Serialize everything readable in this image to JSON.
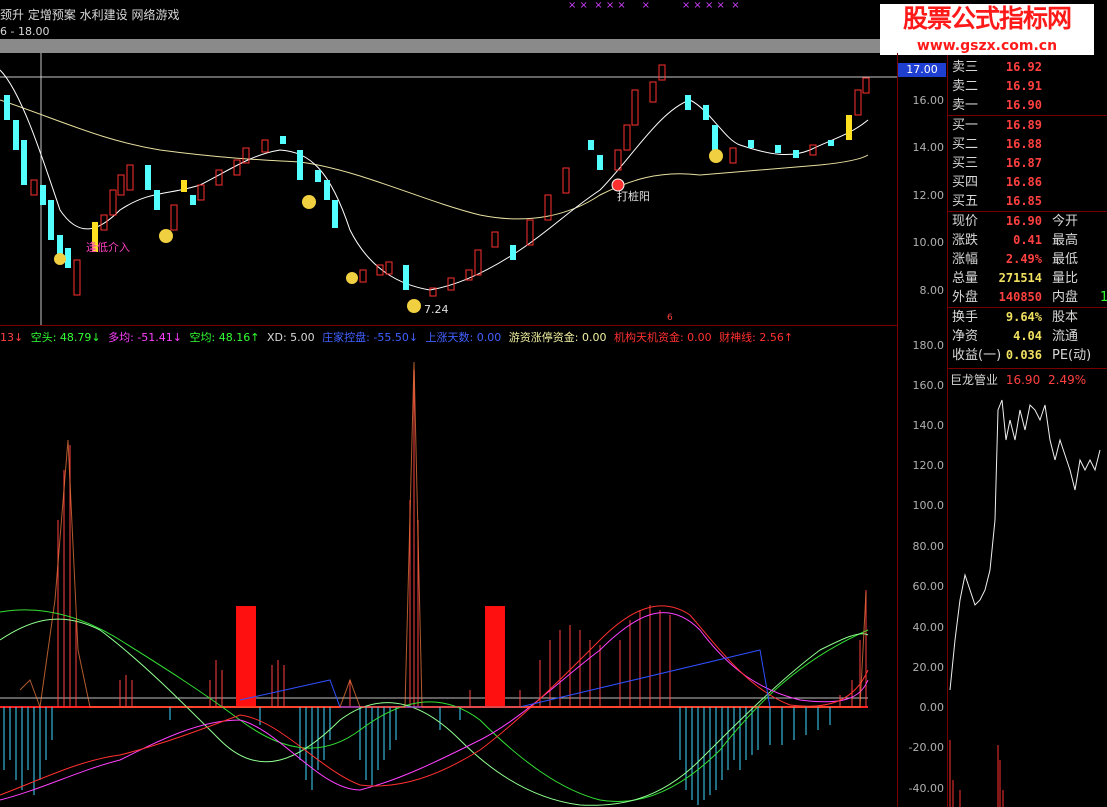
{
  "header": {
    "topline": "颈升 定增预案 水利建设 网络游戏",
    "daterange": "6 - 18.00",
    "markers": "× ×  × × ×     ×          × × × ×  ×",
    "markers_color": "#d040ff"
  },
  "brand": {
    "title": "股票公式指标网",
    "url": "www.gszx.com.cn",
    "color": "#ff1a1a"
  },
  "price_axis": {
    "current_tag": "17.00",
    "ticks": [
      "16.00",
      "14.00",
      "12.00",
      "10.00",
      "8.00"
    ]
  },
  "indicator_axis": {
    "ticks": [
      "180.0",
      "160.0",
      "140.0",
      "120.0",
      "100.0",
      "80.00",
      "60.00",
      "40.00",
      "20.00",
      "0.00",
      "-20.00",
      "-40.00"
    ]
  },
  "main_annotations": {
    "low_entry": "逢低介入",
    "low_price": "7.24",
    "stake_yang": "打桩阳",
    "marker_6": "6"
  },
  "indicator_line": {
    "items": [
      {
        "text": "13↓",
        "color": "#ff4040"
      },
      {
        "text": "空头: 48.79↓",
        "color": "#33ff33"
      },
      {
        "text": "多均: -51.41↓",
        "color": "#ff40ff"
      },
      {
        "text": "空均: 48.16↑",
        "color": "#33ff33"
      },
      {
        "text": "XD: 5.00",
        "color": "#d8d8d8"
      },
      {
        "text": "庄家控盘: -55.50↓",
        "color": "#4060ff"
      },
      {
        "text": "上涨天数: 0.00",
        "color": "#4060ff"
      },
      {
        "text": "游资涨停资金: 0.00",
        "color": "#f0f0a0"
      },
      {
        "text": "机构天机资金: 0.00",
        "color": "#ff3030"
      },
      {
        "text": "财神线: 2.56↑",
        "color": "#ff3030"
      }
    ]
  },
  "quotes": {
    "asks": [
      {
        "label": "卖三",
        "price": "16.92"
      },
      {
        "label": "卖二",
        "price": "16.91"
      },
      {
        "label": "卖一",
        "price": "16.90"
      }
    ],
    "bids": [
      {
        "label": "买一",
        "price": "16.89"
      },
      {
        "label": "买二",
        "price": "16.88"
      },
      {
        "label": "买三",
        "price": "16.87"
      },
      {
        "label": "买四",
        "price": "16.86"
      },
      {
        "label": "买五",
        "price": "16.85"
      }
    ]
  },
  "stats": [
    {
      "label": "现价",
      "value": "16.90",
      "label2": "今开",
      "color": "#ff4040"
    },
    {
      "label": "涨跌",
      "value": "0.41",
      "label2": "最高",
      "color": "#ff4040"
    },
    {
      "label": "涨幅",
      "value": "2.49%",
      "label2": "最低",
      "color": "#ff4040"
    },
    {
      "label": "总量",
      "value": "271514",
      "label2": "量比",
      "color": "#f0e060"
    },
    {
      "label": "外盘",
      "value": "140850",
      "label2": "内盘",
      "color": "#ff4040"
    },
    {
      "label": "换手",
      "value": "9.64%",
      "label2": "股本",
      "color": "#f0e060"
    },
    {
      "label": "净资",
      "value": "4.04",
      "label2": "流通",
      "color": "#f0e060"
    },
    {
      "label": "收益(一)",
      "value": "0.036",
      "label2": "PE(动)",
      "color": "#f0e060"
    }
  ],
  "stats_extra": "1",
  "mini_chart": {
    "name": "巨龙管业",
    "price": "16.90",
    "change": "2.49%"
  }
}
